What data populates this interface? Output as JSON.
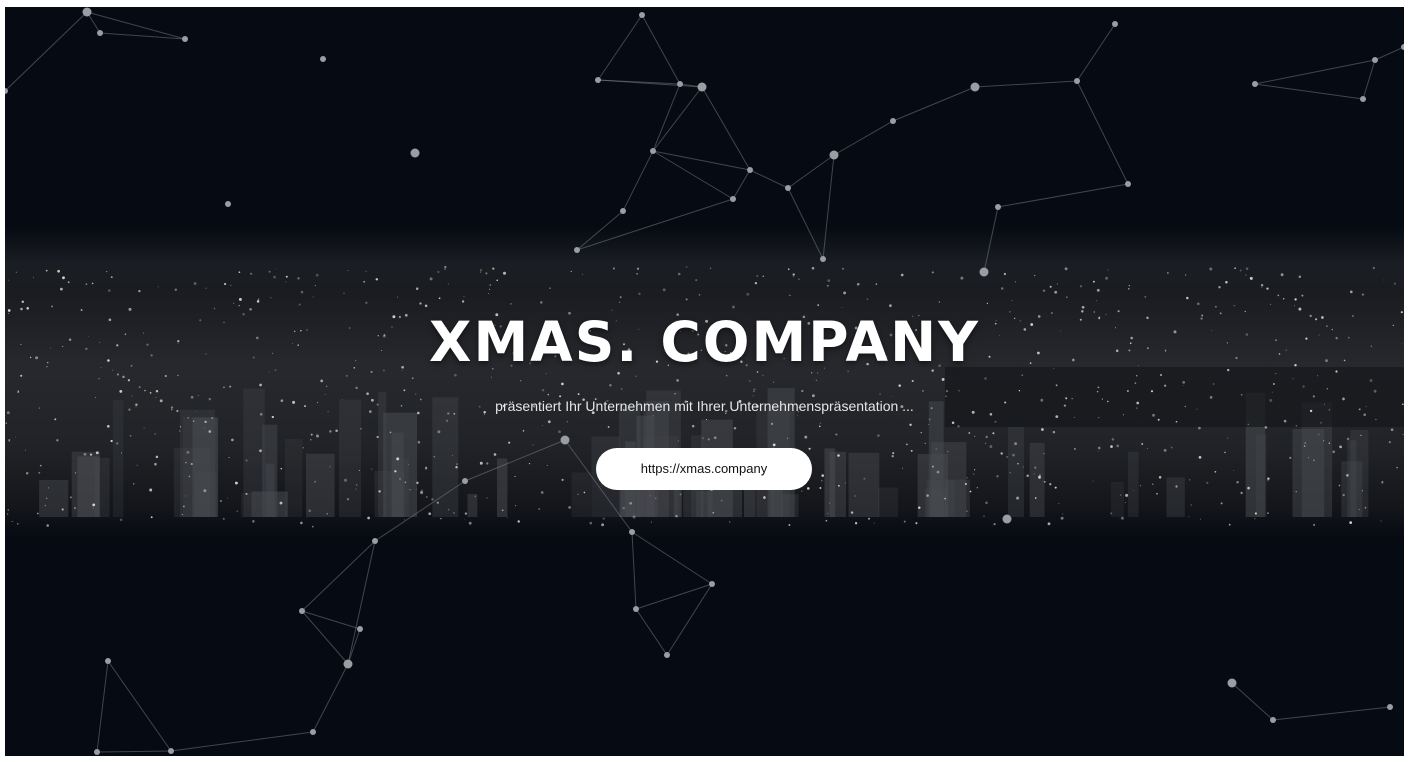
{
  "hero": {
    "title": "XMAS. COMPANY",
    "subtitle": "präsentiert Ihr Unternehmen mit Ihrer Unternehmenspräsentation ...",
    "cta_label": "https://xmas.company"
  },
  "colors": {
    "background": "#060a12",
    "text": "#ffffff",
    "button_bg": "#ffffff",
    "button_text": "#111111",
    "network_line": "#8a8f96"
  },
  "decorations": {
    "background_image": "night-city-skyline",
    "overlay": "particle-network"
  }
}
